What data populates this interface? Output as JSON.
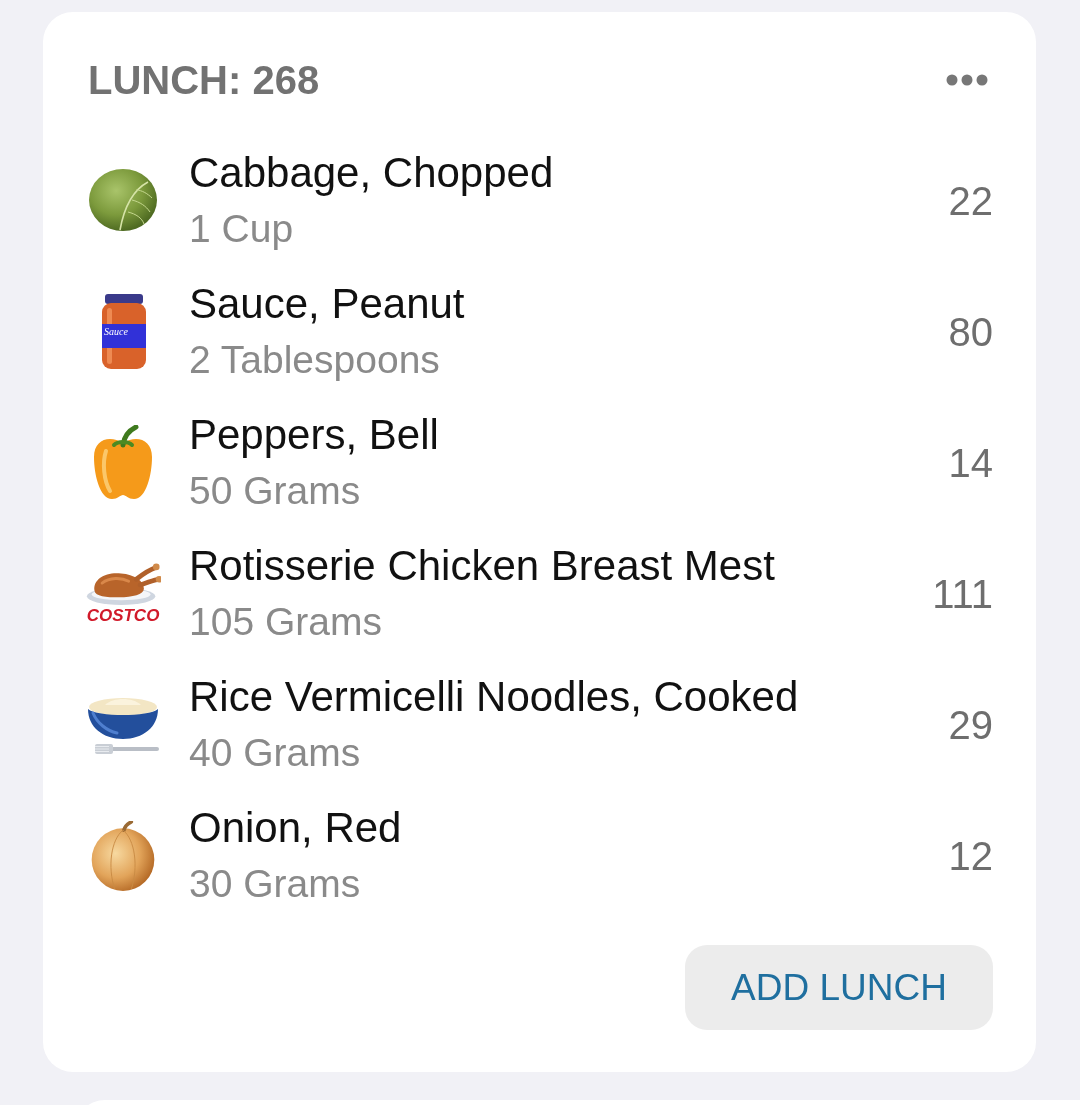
{
  "meal": {
    "title": "LUNCH: 268"
  },
  "foods": [
    {
      "kind": "cabbage",
      "name": "Cabbage, Chopped",
      "serving": "1 Cup",
      "calories": "22"
    },
    {
      "kind": "jar",
      "icon_text": "Sauce",
      "name": "Sauce, Peanut",
      "serving": "2 Tablespoons",
      "calories": "80"
    },
    {
      "kind": "pepper",
      "name": "Peppers, Bell",
      "serving": "50 Grams",
      "calories": "14"
    },
    {
      "kind": "chicken",
      "icon_text": "COSTCO",
      "name": "Rotisserie Chicken Breast Mest",
      "serving": "105 Grams",
      "calories": "111"
    },
    {
      "kind": "bowl",
      "name": "Rice Vermicelli Noodles, Cooked",
      "serving": "40 Grams",
      "calories": "29"
    },
    {
      "kind": "onion",
      "name": "Onion, Red",
      "serving": "30 Grams",
      "calories": "12"
    }
  ],
  "add_button": {
    "label": "ADD LUNCH"
  }
}
